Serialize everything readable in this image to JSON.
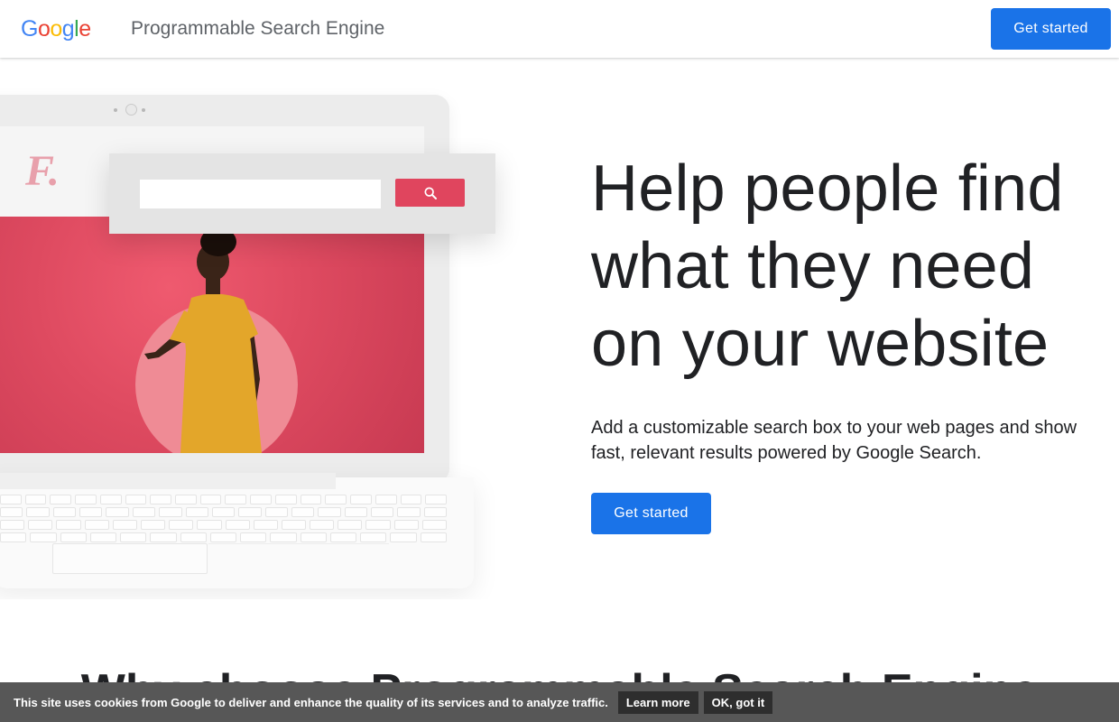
{
  "header": {
    "logo_letters": [
      {
        "ch": "G",
        "color": "#4285F4"
      },
      {
        "ch": "o",
        "color": "#EA4335"
      },
      {
        "ch": "o",
        "color": "#FBBC05"
      },
      {
        "ch": "g",
        "color": "#4285F4"
      },
      {
        "ch": "l",
        "color": "#34A853"
      },
      {
        "ch": "e",
        "color": "#EA4335"
      }
    ],
    "logo_text": "Google",
    "product_name": "Programmable Search Engine",
    "cta_label": "Get started"
  },
  "illustration": {
    "brand_mark": "F.",
    "search_icon": "search-icon",
    "accent_color": "#e0455e"
  },
  "hero": {
    "title": "Help people find what they need on your website",
    "subtitle": "Add a customizable search box to your web pages and show fast, relevant results powered by Google Search.",
    "cta_label": "Get started"
  },
  "section": {
    "title": "Why choose Programmable Search Engine"
  },
  "cookie_bar": {
    "text": "This site uses cookies from Google to deliver and enhance the quality of its services and to analyze traffic.",
    "learn_more_label": "Learn more",
    "ok_label": "OK, got it"
  },
  "colors": {
    "primary": "#1a73e8",
    "cookie_bg": "#575757"
  }
}
